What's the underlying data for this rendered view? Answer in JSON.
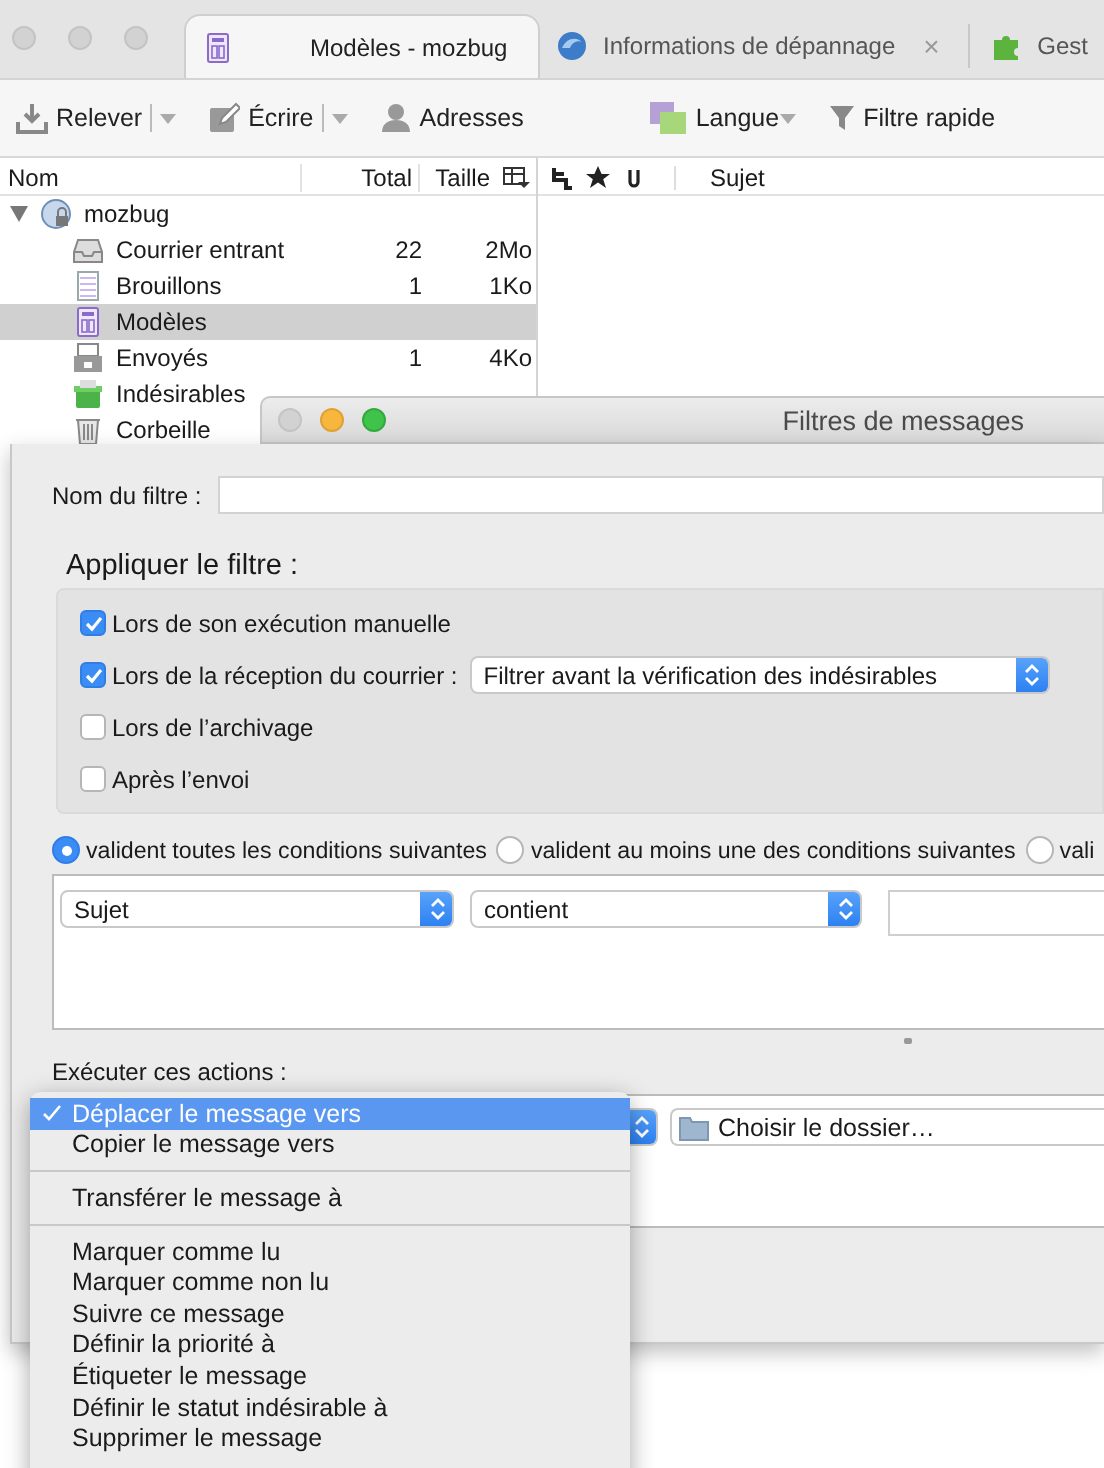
{
  "window": {
    "tabs": [
      {
        "label": "Modèles - mozbug",
        "selected": true
      },
      {
        "label": "Informations de dépannage",
        "selected": false,
        "close": "×"
      },
      {
        "label": "Gest",
        "selected": false
      }
    ]
  },
  "toolbar": [
    {
      "label": "Relever",
      "dropdown": true
    },
    {
      "label": "Écrire",
      "dropdown": true
    },
    {
      "label": "Adresses",
      "dropdown": false
    },
    {
      "label": "Langue",
      "dropdown": true
    },
    {
      "label": "Filtre rapide",
      "dropdown": false
    }
  ],
  "folder_pane": {
    "columns": [
      "Nom",
      "Total",
      "Taille"
    ],
    "tree": [
      {
        "name": "mozbug",
        "kind": "account",
        "expanded": true,
        "selected": false,
        "children": [
          {
            "name": "Courrier entrant",
            "kind": "inbox",
            "total": "22",
            "size": "2Mo",
            "selected": false
          },
          {
            "name": "Brouillons",
            "kind": "drafts",
            "total": "1",
            "size": "1Ko",
            "selected": false
          },
          {
            "name": "Modèles",
            "kind": "templates",
            "selected": true
          },
          {
            "name": "Envoyés",
            "kind": "sent",
            "total": "1",
            "size": "4Ko",
            "selected": false
          },
          {
            "name": "Indésirables",
            "kind": "junk",
            "selected": false
          },
          {
            "name": "Corbeille",
            "kind": "trash",
            "selected": false
          }
        ]
      }
    ]
  },
  "message_pane": {
    "columns": [
      "Sujet"
    ]
  },
  "dialog": {
    "title": "Filtres de messages",
    "name_label": "Nom du filtre :",
    "apply_title": "Appliquer le filtre :",
    "apply_options": [
      {
        "label": "Lors de son exécution manuelle",
        "checked": true
      },
      {
        "label": "Lors de la réception du courrier :",
        "checked": true,
        "select": "Filtrer avant la vérification des indésirables"
      },
      {
        "label": "Lors de l’archivage",
        "checked": false
      },
      {
        "label": "Après l’envoi",
        "checked": false
      }
    ],
    "match_options": [
      {
        "label": "valident toutes les conditions suivantes",
        "selected": true
      },
      {
        "label": "valident au moins une des conditions suivantes",
        "selected": false
      },
      {
        "label": "vali",
        "selected": false
      }
    ],
    "conditions": [
      {
        "attribute": "Sujet",
        "operator": "contient"
      }
    ],
    "actions_label": "Exécuter ces actions :",
    "actions": [
      {
        "folder": "Choisir le dossier…"
      }
    ],
    "action_menu": [
      {
        "kind": "item",
        "label": "Déplacer le message vers",
        "selected": true
      },
      {
        "kind": "item",
        "label": "Copier le message vers",
        "selected": false
      },
      {
        "kind": "separator"
      },
      {
        "kind": "item",
        "label": "Transférer le message à",
        "selected": false
      },
      {
        "kind": "separator"
      },
      {
        "kind": "item",
        "label": "Marquer comme lu",
        "selected": false
      },
      {
        "kind": "item",
        "label": "Marquer comme non lu",
        "selected": false
      },
      {
        "kind": "item",
        "label": "Suivre ce message",
        "selected": false
      },
      {
        "kind": "item",
        "label": "Définir la priorité à",
        "selected": false
      },
      {
        "kind": "item",
        "label": "Étiqueter le message",
        "selected": false
      },
      {
        "kind": "item",
        "label": "Définir le statut indésirable à",
        "selected": false
      },
      {
        "kind": "item",
        "label": "Supprimer le message",
        "selected": false
      }
    ]
  }
}
